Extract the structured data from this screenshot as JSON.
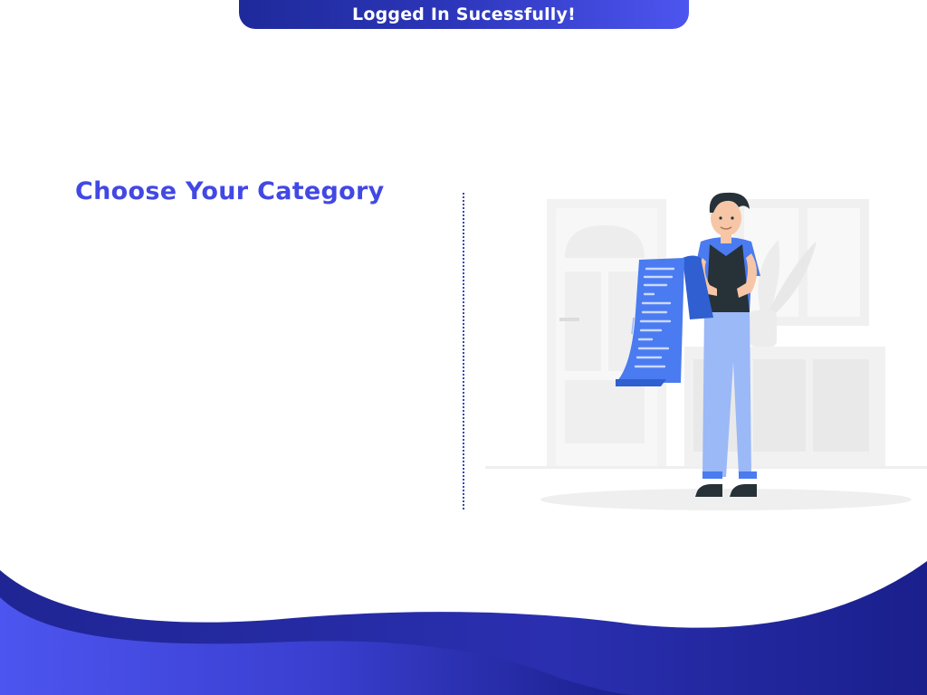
{
  "toast": {
    "message": "Logged In Sucessfully!"
  },
  "main": {
    "title": "Choose Your Category"
  },
  "illustration": {
    "subject": "person-reading-list-illustration"
  },
  "colors": {
    "accent": "#4248e4",
    "toast_start": "#1e2a9a",
    "toast_end": "#4d55f0",
    "wave_dark": "#1e2a9a",
    "wave_light": "#4d55f0",
    "illustration_blue": "#4a7bf0",
    "illustration_pants": "#9bb8f7"
  }
}
